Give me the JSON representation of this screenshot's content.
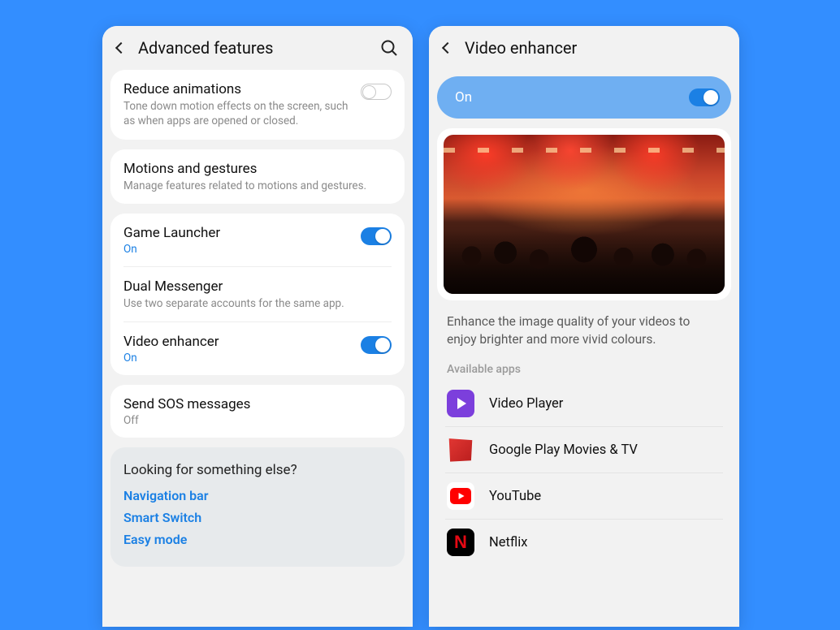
{
  "left": {
    "title": "Advanced features",
    "rows": {
      "reduce_animations": {
        "title": "Reduce animations",
        "sub": "Tone down motion effects on the screen, such as when apps are opened or closed."
      },
      "motions": {
        "title": "Motions and gestures",
        "sub": "Manage features related to motions and gestures."
      },
      "game_launcher": {
        "title": "Game Launcher",
        "status": "On"
      },
      "dual_messenger": {
        "title": "Dual Messenger",
        "sub": "Use two separate accounts for the same app."
      },
      "video_enhancer": {
        "title": "Video enhancer",
        "status": "On"
      },
      "sos": {
        "title": "Send SOS messages",
        "status": "Off"
      }
    },
    "footer": {
      "title": "Looking for something else?",
      "links": [
        "Navigation bar",
        "Smart Switch",
        "Easy mode"
      ]
    }
  },
  "right": {
    "title": "Video enhancer",
    "main_toggle_label": "On",
    "description": "Enhance the image quality of your videos to enjoy brighter and more vivid colours.",
    "section_label": "Available apps",
    "apps": [
      {
        "name": "Video Player"
      },
      {
        "name": "Google Play Movies & TV"
      },
      {
        "name": "YouTube"
      },
      {
        "name": "Netflix"
      }
    ]
  }
}
